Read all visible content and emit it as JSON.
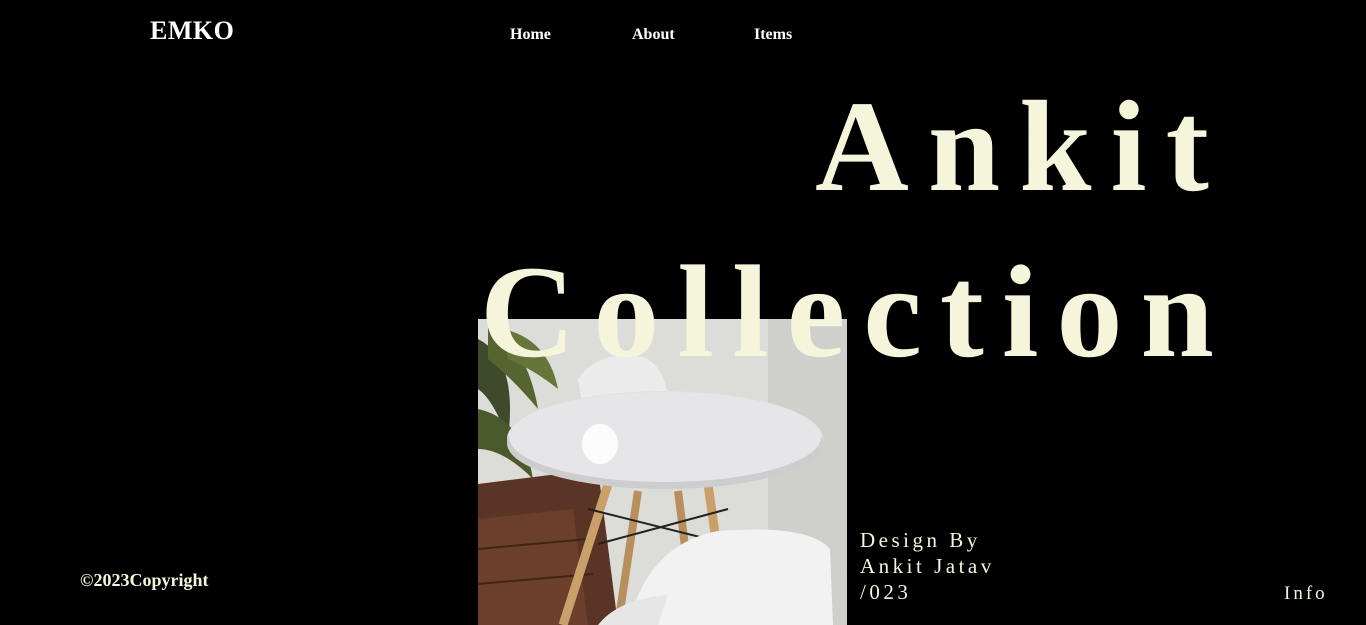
{
  "header": {
    "logo": "EMKO",
    "nav": {
      "home": "Home",
      "about": "About",
      "items": "Items"
    }
  },
  "hero": {
    "line1": "Ankit",
    "line2": "Collection"
  },
  "credit": {
    "line1": "Design By",
    "line2": "Ankit Jatav",
    "line3": "/023"
  },
  "footer": {
    "copyright": "©2023Copyright",
    "info": "Info"
  },
  "colors": {
    "background": "#000000",
    "text_cream": "#f5f5dc",
    "nav_white": "#ffffff"
  }
}
